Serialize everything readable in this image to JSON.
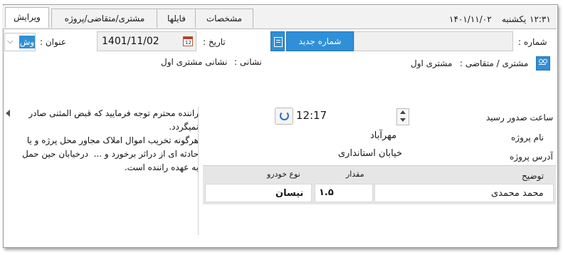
{
  "tabs": [
    {
      "label": "ویرایش",
      "active": true
    },
    {
      "label": "مشتری/متقاضی/پروژه",
      "active": false
    },
    {
      "label": "فایلها",
      "active": false
    },
    {
      "label": "مشخصات",
      "active": false
    }
  ],
  "header": {
    "date": "۱۴۰۱/۱۱/۰۲",
    "weekday": "یکشنبه",
    "time": "۱۲:۳۱"
  },
  "form": {
    "title_label": "عنوان :",
    "title_value": "وش",
    "date_label": "تاریخ :",
    "date_value": "1401/11/02",
    "new_number_button": "شماره جدید",
    "number_label": "شماره :",
    "number_value": ""
  },
  "customer": {
    "label": "مشتری / متقاضی :",
    "value": "مشتری اول",
    "address_label": "نشانی :",
    "address_value": "نشانی مشتری اول"
  },
  "details": {
    "issue_time_label": "ساعت صدور رسید",
    "issue_time_value": "12:17",
    "project_name_label": "نام پروژه",
    "project_name_value": "مهرآباد",
    "project_address_label": "آدرس پروژه",
    "project_address_value": "خیابان استانداری",
    "description_label": "توضیح"
  },
  "note": {
    "text": "راننده محترم توجه فرمایید که قبض المثنی صادر نمیگردد.\nهرگونه تخریب اموال املاک مجاور محل پرژه و یا حادثه ای از دراثر برخورد و ...  درخیابان حین حمل به عهده راننده است."
  },
  "table": {
    "columns": [
      "توضیح",
      "مقدار",
      "نوع خودرو"
    ],
    "rows": [
      {
        "description": "محمد محمدی",
        "amount": "۱.۵",
        "vehicle": "نیسان"
      }
    ]
  },
  "colors": {
    "accent": "#2f8fd8",
    "tab_bg": "#f2f2f2",
    "grid_header": "#e3e3e3"
  }
}
